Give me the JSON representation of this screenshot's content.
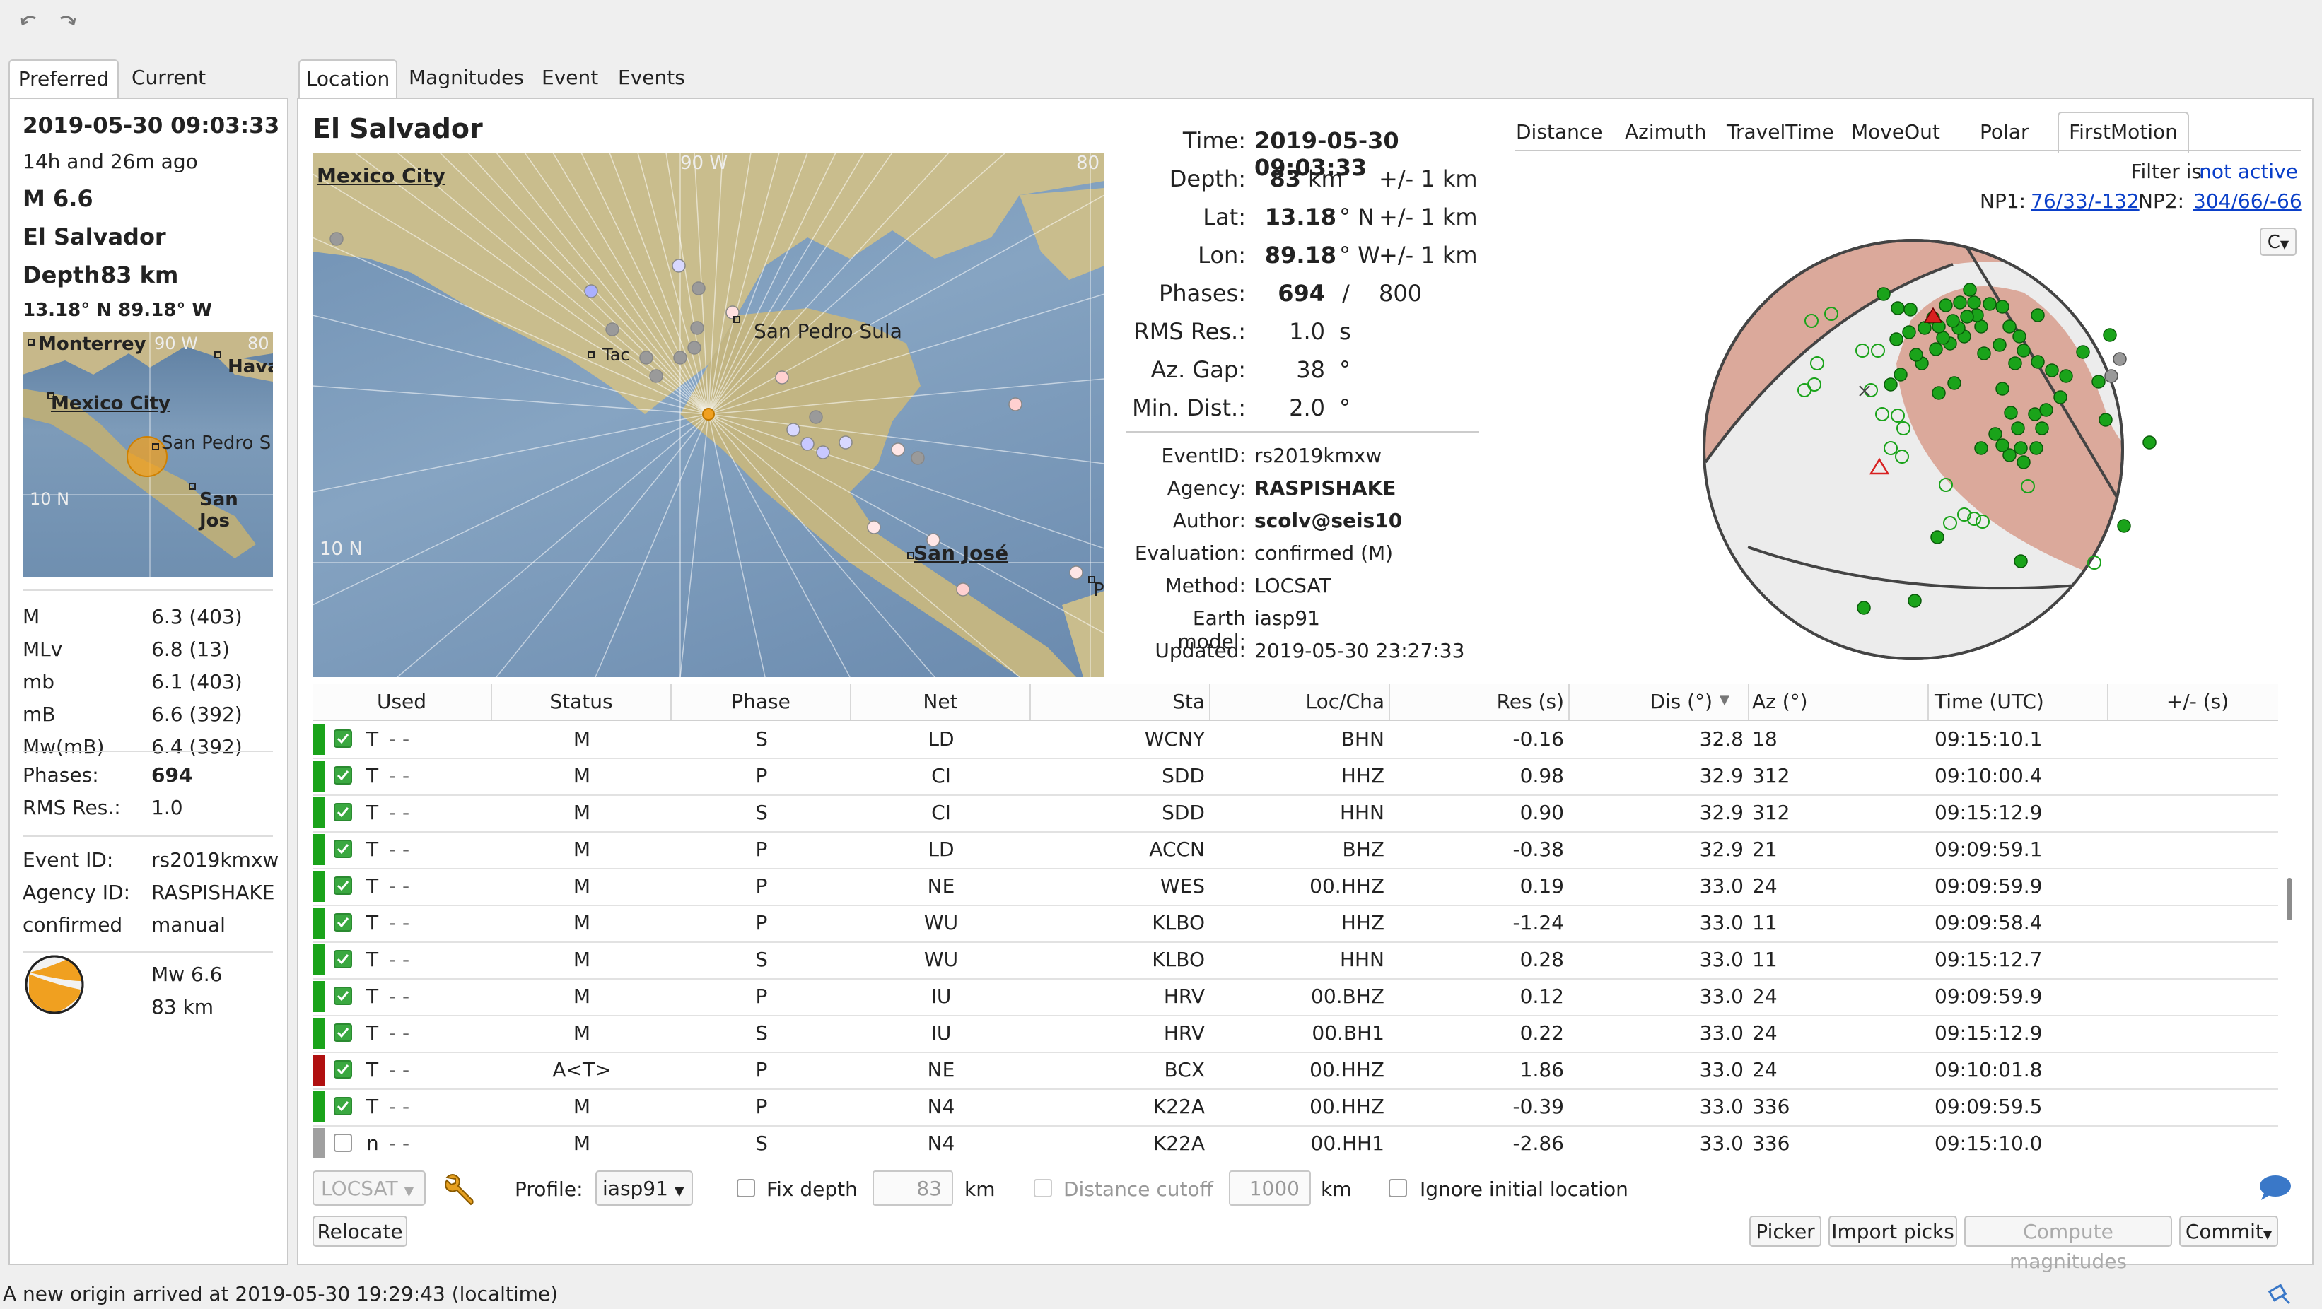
{
  "toolbar": {
    "undo_icon": "undo-icon",
    "redo_icon": "redo-icon"
  },
  "left_tabs": {
    "preferred": "Preferred",
    "current": "Current"
  },
  "summary": {
    "time": "2019-05-30 09:03:33",
    "ago": "14h and 26m ago",
    "mag": "M 6.6",
    "region": "El Salvador",
    "depth_label": "Depth",
    "depth_value": "83 km",
    "coords": "13.18° N  89.18° W",
    "map_labels": {
      "monterrey": "Monterrey",
      "havana": "Havan",
      "mexico": "Mexico City",
      "sanpedro": "San Pedro S",
      "sanjose": "San Jos",
      "lat": "10 N",
      "lon90": "90 W",
      "lon80": "80"
    },
    "magnitudes": [
      {
        "type": "M",
        "value": "6.3 (403)"
      },
      {
        "type": "MLv",
        "value": "6.8 (13)"
      },
      {
        "type": "mb",
        "value": "6.1 (403)"
      },
      {
        "type": "mB",
        "value": "6.6 (392)"
      },
      {
        "type": "Mw(mB)",
        "value": "6.4 (392)"
      }
    ],
    "phases_label": "Phases:",
    "phases_value": "694",
    "rms_label": "RMS Res.:",
    "rms_value": "1.0",
    "eventid_label": "Event ID:",
    "eventid_value": "rs2019kmxw",
    "agency_label": "Agency ID:",
    "agency_value": "RASPISHAKE",
    "status_label": "confirmed",
    "status_value": "manual",
    "beachball_mw": "Mw 6.6",
    "beachball_depth": "83 km"
  },
  "main_tabs": {
    "location": "Location",
    "magnitudes": "Magnitudes",
    "event": "Event",
    "events": "Events"
  },
  "region_title": "El Salvador",
  "map_labels": {
    "mexico": "Mexico City",
    "sanpedro": "San Pedro Sula",
    "tac": "Tac",
    "sanjose": "San José",
    "lat": "10 N",
    "lon90": "90 W",
    "lon80": "80",
    "p": "P"
  },
  "origin": {
    "time_label": "Time:",
    "time_value": "2019-05-30 09:03:33",
    "depth_label": "Depth:",
    "depth_value": "83",
    "depth_unit": "km",
    "depth_err": "+/- 1  km",
    "lat_label": "Lat:",
    "lat_value": "13.18",
    "lat_unit": "° N",
    "lat_err": "+/- 1  km",
    "lon_label": "Lon:",
    "lon_value": "89.18",
    "lon_unit": "° W",
    "lon_err": "+/- 1  km",
    "phases_label": "Phases:",
    "phases_value": "694",
    "phases_sep": "/",
    "phases_total": "800",
    "rms_label": "RMS Res.:",
    "rms_value": "1.0",
    "rms_unit": "s",
    "gap_label": "Az. Gap:",
    "gap_value": "38",
    "gap_unit": "°",
    "mindist_label": "Min. Dist.:",
    "mindist_value": "2.0",
    "mindist_unit": "°",
    "eventid_label": "EventID:",
    "eventid_value": "rs2019kmxw",
    "agency_label": "Agency:",
    "agency_value": "RASPISHAKE",
    "author_label": "Author:",
    "author_value": "scolv@seis10",
    "eval_label": "Evaluation:",
    "eval_value": "confirmed (M)",
    "method_label": "Method:",
    "method_value": "LOCSAT",
    "model_label": "Earth model:",
    "model_value": "iasp91",
    "updated_label": "Updated:",
    "updated_value": "2019-05-30 23:27:33"
  },
  "plot_tabs": {
    "distance": "Distance",
    "azimuth": "Azimuth",
    "traveltime": "TravelTime",
    "moveout": "MoveOut",
    "polar": "Polar",
    "firstmotion": "FirstMotion"
  },
  "firstmotion": {
    "filter_label": "Filter is",
    "filter_value": "not active",
    "np1_label": "NP1:",
    "np1_value": "76/33/-132",
    "np2_label": "NP2:",
    "np2_value": "304/66/-66",
    "dropdown": "C"
  },
  "table": {
    "headers": [
      "Used",
      "Status",
      "Phase",
      "Net",
      "Sta",
      "Loc/Cha",
      "Res (s)",
      "Dis (°)",
      "Az (°)",
      "Time (UTC)",
      "+/- (s)"
    ],
    "rows": [
      {
        "flag": "#1aa31a",
        "checked": true,
        "t": "T",
        "dash": "-  -",
        "status": "M",
        "phase": "S",
        "net": "LD",
        "sta": "WCNY",
        "cha": "BHN",
        "res": "-0.16",
        "dis": "32.8",
        "az": "18",
        "time": "09:15:10.1"
      },
      {
        "flag": "#1aa31a",
        "checked": true,
        "t": "T",
        "dash": "-  -",
        "status": "M",
        "phase": "P",
        "net": "CI",
        "sta": "SDD",
        "cha": "HHZ",
        "res": "0.98",
        "dis": "32.9",
        "az": "312",
        "time": "09:10:00.4"
      },
      {
        "flag": "#1aa31a",
        "checked": true,
        "t": "T",
        "dash": "-  -",
        "status": "M",
        "phase": "S",
        "net": "CI",
        "sta": "SDD",
        "cha": "HHN",
        "res": "0.90",
        "dis": "32.9",
        "az": "312",
        "time": "09:15:12.9"
      },
      {
        "flag": "#1aa31a",
        "checked": true,
        "t": "T",
        "dash": "-  -",
        "status": "M",
        "phase": "P",
        "net": "LD",
        "sta": "ACCN",
        "cha": "BHZ",
        "res": "-0.38",
        "dis": "32.9",
        "az": "21",
        "time": "09:09:59.1"
      },
      {
        "flag": "#1aa31a",
        "checked": true,
        "t": "T",
        "dash": "-  -",
        "status": "M",
        "phase": "P",
        "net": "NE",
        "sta": "WES",
        "cha": "00.HHZ",
        "res": "0.19",
        "dis": "33.0",
        "az": "24",
        "time": "09:09:59.9"
      },
      {
        "flag": "#1aa31a",
        "checked": true,
        "t": "T",
        "dash": "-  -",
        "status": "M",
        "phase": "P",
        "net": "WU",
        "sta": "KLBO",
        "cha": "HHZ",
        "res": "-1.24",
        "dis": "33.0",
        "az": "11",
        "time": "09:09:58.4"
      },
      {
        "flag": "#1aa31a",
        "checked": true,
        "t": "T",
        "dash": "-  -",
        "status": "M",
        "phase": "S",
        "net": "WU",
        "sta": "KLBO",
        "cha": "HHN",
        "res": "0.28",
        "dis": "33.0",
        "az": "11",
        "time": "09:15:12.7"
      },
      {
        "flag": "#1aa31a",
        "checked": true,
        "t": "T",
        "dash": "-  -",
        "status": "M",
        "phase": "P",
        "net": "IU",
        "sta": "HRV",
        "cha": "00.BHZ",
        "res": "0.12",
        "dis": "33.0",
        "az": "24",
        "time": "09:09:59.9"
      },
      {
        "flag": "#1aa31a",
        "checked": true,
        "t": "T",
        "dash": "-  -",
        "status": "M",
        "phase": "S",
        "net": "IU",
        "sta": "HRV",
        "cha": "00.BH1",
        "res": "0.22",
        "dis": "33.0",
        "az": "24",
        "time": "09:15:12.9"
      },
      {
        "flag": "#b01010",
        "checked": true,
        "t": "T",
        "dash": "-  -",
        "status": "A<T>",
        "phase": "P",
        "net": "NE",
        "sta": "BCX",
        "cha": "00.HHZ",
        "res": "1.86",
        "dis": "33.0",
        "az": "24",
        "time": "09:10:01.8"
      },
      {
        "flag": "#1aa31a",
        "checked": true,
        "t": "T",
        "dash": "-  -",
        "status": "M",
        "phase": "P",
        "net": "N4",
        "sta": "K22A",
        "cha": "00.HHZ",
        "res": "-0.39",
        "dis": "33.0",
        "az": "336",
        "time": "09:09:59.5"
      },
      {
        "flag": "#a0a0a0",
        "checked": false,
        "t": "n",
        "dash": "-  -",
        "status": "M",
        "phase": "S",
        "net": "N4",
        "sta": "K22A",
        "cha": "00.HH1",
        "res": "-2.86",
        "dis": "33.0",
        "az": "336",
        "time": "09:15:10.0"
      }
    ]
  },
  "bottom": {
    "locator": "LOCSAT",
    "profile_label": "Profile:",
    "profile_value": "iasp91",
    "fixdepth_label": "Fix depth",
    "fixdepth_value": "83",
    "fixdepth_unit": "km",
    "distcutoff_label": "Distance cutoff",
    "distcutoff_value": "1000",
    "distcutoff_unit": "km",
    "ignore_label": "Ignore initial location",
    "relocate": "Relocate",
    "picker": "Picker",
    "import_picks": "Import picks",
    "compute_mags": "Compute magnitudes",
    "commit": "Commit"
  },
  "statusbar": {
    "message": "A new origin arrived at 2019-05-30 19:29:43 (localtime)"
  },
  "colors": {
    "accent_green": "#1aa31a",
    "accent_red": "#b01010",
    "link": "#0a3fc9",
    "beachball": "#e0b8aa"
  }
}
